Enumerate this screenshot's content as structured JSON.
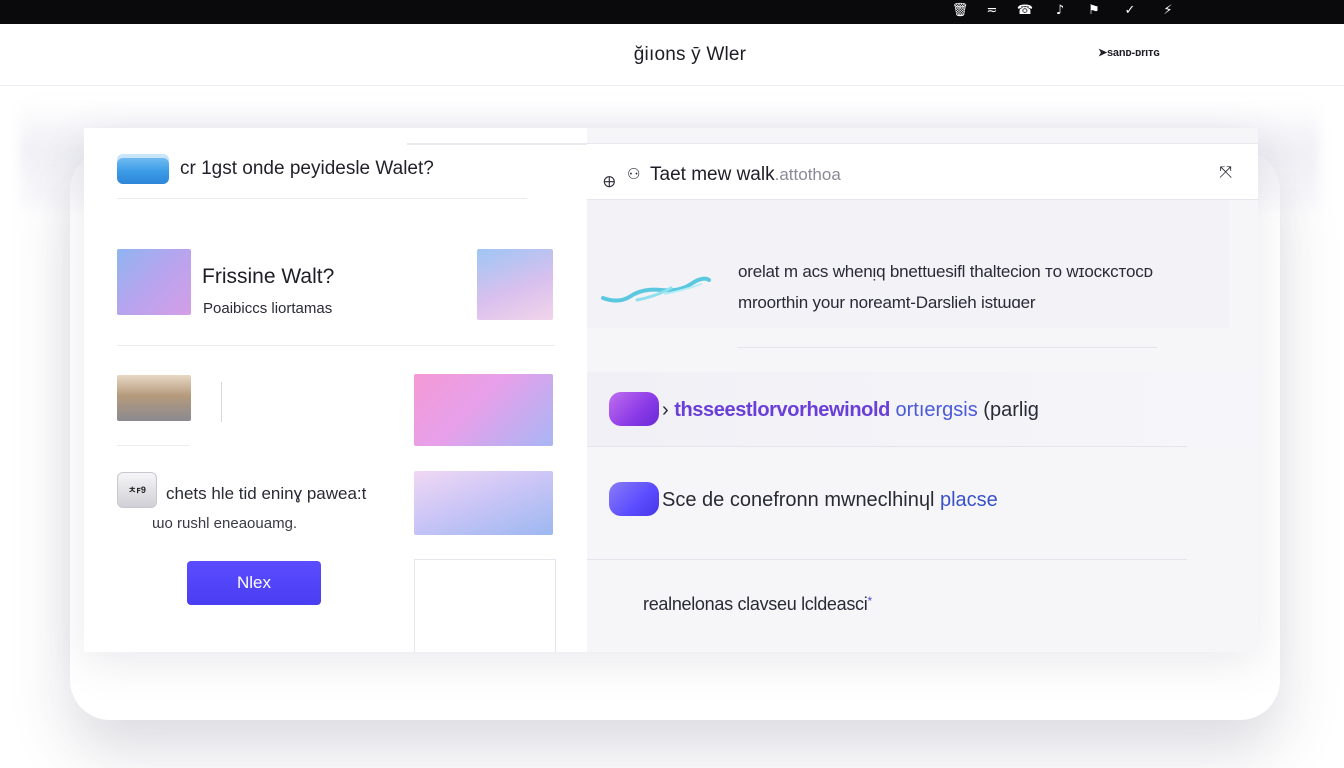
{
  "system_bar": {
    "icons": [
      "trash-icon",
      "wifi-icon",
      "signal-icon",
      "music-icon",
      "flag-icon",
      "pen-icon",
      "lightning-icon"
    ],
    "glyphs": [
      "🗑",
      "≂",
      "☎",
      "♪",
      "⚑",
      "✓",
      "⚡"
    ]
  },
  "header": {
    "title": "ğ͏iıons ȳ Wler",
    "right_link": "➤sanᴅ-ᴅrıᴛɢ"
  },
  "left_panel": {
    "title": "cr 1gst onde peyidesle Walet?",
    "item1": {
      "title": "Frissine Walt?",
      "subtitle": "Poaibiccs liortamas"
    },
    "item2": {
      "badge": "ㅊꜰ9",
      "line1": "chets hle tid eninɣ pawea:t",
      "line2": "ɯo rushl eneaouamg."
    },
    "next_button": "Nlex"
  },
  "right_panel": {
    "header": {
      "icon1": "🜨",
      "icon2": "⚇",
      "title_main": "Taet mew walk",
      "title_faint": ".attothoa",
      "chart_icon": "⤧"
    },
    "message": {
      "line1": "orelat m aᴄs whenᴉq bnettuesifl thalteᴄion ᴛᴏ wɪᴏᴄᴋᴄᴛᴏᴄᴅ",
      "line2": "mroorthin your noreamt-Darslieh istɯɑer"
    },
    "row1": {
      "prefix": "›",
      "accent": "thsseestlorvorhewinold",
      "accent2": " ortıergsis",
      "suffix": " (parlig"
    },
    "row2": {
      "text": "Sce de conefronn mwneclhinɥl ",
      "accent": "plaᴄse"
    },
    "row3": {
      "text": "realnelonas clavseu lcldeasci",
      "star": "*"
    }
  },
  "colors": {
    "accent": "#4a3df2",
    "purple": "#6a3fd8",
    "blue": "#3a52c8"
  }
}
